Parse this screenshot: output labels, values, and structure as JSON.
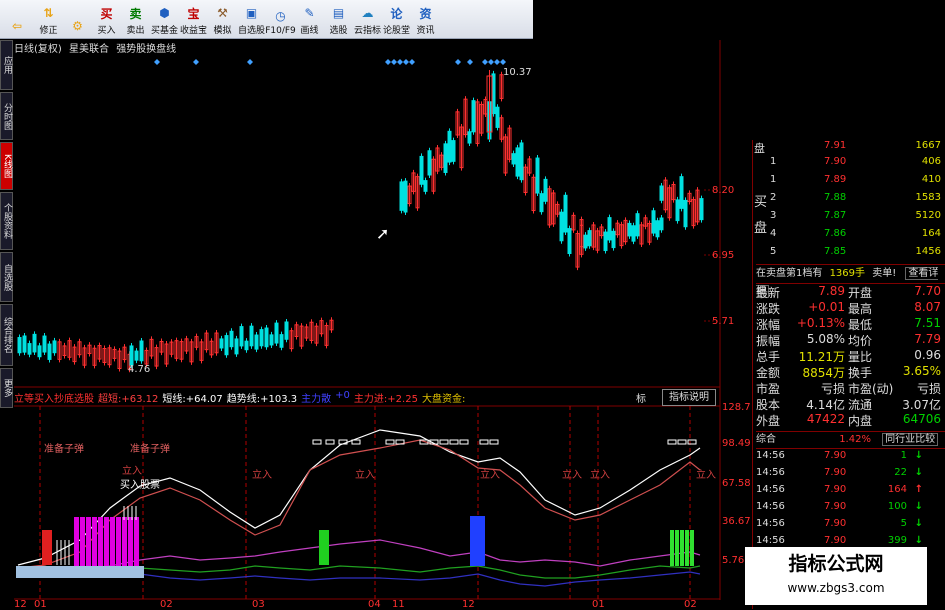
{
  "toolbar": {
    "buttons": [
      {
        "label": "",
        "icon": "back-arrow-icon",
        "glyph": "⇦",
        "color": "#e8a317"
      },
      {
        "label": "修正",
        "icon": "up-down-arrow-icon",
        "glyph": "⇅",
        "color": "#e8a317"
      },
      {
        "label": "",
        "icon": "settings-wheel-icon",
        "glyph": "⚙",
        "color": "#e8a317"
      },
      {
        "label": "买入",
        "icon": "buy-icon",
        "glyph": "买",
        "color": "#c00000"
      },
      {
        "label": "卖出",
        "icon": "sell-icon",
        "glyph": "卖",
        "color": "#007a00"
      },
      {
        "label": "买基金",
        "icon": "fund-icon",
        "glyph": "⬢",
        "color": "#2060c0"
      },
      {
        "label": "收益宝",
        "icon": "treasure-icon",
        "glyph": "宝",
        "color": "#c00000"
      },
      {
        "label": "模拟",
        "icon": "hammer-icon",
        "glyph": "⚒",
        "color": "#8a5a2a"
      },
      {
        "label": "自选股",
        "icon": "save-icon",
        "glyph": "▣",
        "color": "#2060c0"
      },
      {
        "label": "F10/F9",
        "icon": "clock-icon",
        "glyph": "◷",
        "color": "#2060c0"
      },
      {
        "label": "画线",
        "icon": "pencil-icon",
        "glyph": "✎",
        "color": "#2060c0"
      },
      {
        "label": "选股",
        "icon": "chart-icon",
        "glyph": "▤",
        "color": "#2060c0"
      },
      {
        "label": "云指标",
        "icon": "cloud-indicator-icon",
        "glyph": "☁",
        "color": "#2080c0"
      },
      {
        "label": "论股堂",
        "icon": "forum-icon",
        "glyph": "论",
        "color": "#2060c0"
      },
      {
        "label": "资讯",
        "icon": "news-icon",
        "glyph": "资",
        "color": "#2060c0"
      }
    ]
  },
  "sidebar": [
    {
      "label": "应用",
      "active": false
    },
    {
      "label": "分时图",
      "active": false
    },
    {
      "label": "K线图",
      "active": true
    },
    {
      "label": "个股资料",
      "active": false
    },
    {
      "label": "自选股",
      "active": false
    },
    {
      "label": "综合排名",
      "active": false
    },
    {
      "label": "更多",
      "active": false
    }
  ],
  "chart_header": {
    "period": "日线(复权)",
    "stock": "星美联合",
    "indicator": "强势股换盘线"
  },
  "main_chart": {
    "price_levels": [
      "8.20",
      "6.95",
      "5.71"
    ],
    "high_label": "10.37",
    "low_label": "4.76"
  },
  "indicator_bar": {
    "name": "立等买入抄底选股",
    "items": [
      {
        "label": "超短:",
        "value": "+63.12",
        "color": "#ff4040"
      },
      {
        "label": "短线:",
        "value": "+64.07",
        "color": "#ffffff"
      },
      {
        "label": "趋势线:",
        "value": "+103.3",
        "color": "#ffffff"
      },
      {
        "label": "主力散",
        "value": "",
        "color": "#4040ff"
      },
      {
        "label": "+0",
        "value": "",
        "color": "#4040ff"
      },
      {
        "label": "主力进:",
        "value": "+2.25",
        "color": "#ff3030"
      },
      {
        "label": "大盘资金:",
        "value": "",
        "color": "#e0c000"
      }
    ],
    "tab": "标",
    "button": "指标说明"
  },
  "lower_chart": {
    "levels": [
      "128.7",
      "98.49",
      "67.58",
      "36.67",
      "5.76"
    ],
    "signals": [
      "准备子弹",
      "准备子弹",
      "立入",
      "买入股票",
      "立入",
      "立入",
      "立入",
      "立入",
      "立入",
      "立入"
    ]
  },
  "date_axis": [
    "12",
    "01",
    "02",
    "03",
    "04",
    "11",
    "12",
    "01",
    "02"
  ],
  "order_book": {
    "sell": [
      {
        "label": "",
        "price": "7.91",
        "vol": "1667"
      },
      {
        "label": "1",
        "price": "7.90",
        "vol": "406"
      }
    ],
    "buy": [
      {
        "label": "1",
        "price": "7.89",
        "vol": "410"
      },
      {
        "label": "2",
        "price": "7.88",
        "vol": "1583"
      },
      {
        "label": "3",
        "price": "7.87",
        "vol": "5120"
      },
      {
        "label": "4",
        "price": "7.86",
        "vol": "164"
      },
      {
        "label": "5",
        "price": "7.85",
        "vol": "1456"
      }
    ],
    "side_label_buy": "买",
    "side_label_pan": "盘",
    "sell_side_label": "盘"
  },
  "depth_row": {
    "label": "在卖盘第1档有",
    "vol": "1369手",
    "sell1": "卖单!",
    "detail": "查看详细"
  },
  "quote": [
    {
      "k1": "最新",
      "v1": "7.89",
      "k2": "开盘",
      "v2": "7.70",
      "c1": "#ff3030",
      "c2": "#ff3030"
    },
    {
      "k1": "涨跌",
      "v1": "+0.01",
      "k2": "最高",
      "v2": "8.07",
      "c1": "#ff3030",
      "c2": "#ff3030"
    },
    {
      "k1": "涨幅",
      "v1": "+0.13%",
      "k2": "最低",
      "v2": "7.51",
      "c1": "#ff3030",
      "c2": "#00d000"
    },
    {
      "k1": "振幅",
      "v1": "5.08%",
      "k2": "均价",
      "v2": "7.79",
      "c1": "#dddddd",
      "c2": "#ff3030"
    },
    {
      "k1": "总手",
      "v1": "11.21万",
      "k2": "量比",
      "v2": "0.96",
      "c1": "#e0e000",
      "c2": "#dddddd"
    },
    {
      "k1": "金额",
      "v1": "8854万",
      "k2": "换手",
      "v2": "3.65%",
      "c1": "#e0e000",
      "c2": "#e0e000"
    },
    {
      "k1": "市盈",
      "v1": "亏损",
      "k2": "市盈(动)",
      "v2": "亏损",
      "c1": "#dddddd",
      "c2": "#dddddd"
    },
    {
      "k1": "股本",
      "v1": "4.14亿",
      "k2": "流通",
      "v2": "3.07亿",
      "c1": "#dddddd",
      "c2": "#dddddd"
    },
    {
      "k1": "外盘",
      "v1": "47422",
      "k2": "内盘",
      "v2": "64706",
      "c1": "#ff3030",
      "c2": "#00d000"
    }
  ],
  "summary": {
    "label": "综合",
    "value": "1.42%",
    "link": "同行业比较"
  },
  "ticks": [
    {
      "time": "14:56",
      "price": "7.90",
      "vol": "1",
      "dir": "down"
    },
    {
      "time": "14:56",
      "price": "7.90",
      "vol": "22",
      "dir": "down"
    },
    {
      "time": "14:56",
      "price": "7.90",
      "vol": "164",
      "dir": "up"
    },
    {
      "time": "14:56",
      "price": "7.90",
      "vol": "100",
      "dir": "down"
    },
    {
      "time": "14:56",
      "price": "7.90",
      "vol": "5",
      "dir": "down"
    },
    {
      "time": "14:56",
      "price": "7.90",
      "vol": "399",
      "dir": "down"
    }
  ],
  "watermark": {
    "title": "指标公式网",
    "url": "www.zbgs3.com"
  },
  "colors": {
    "up": "#ff3030",
    "down": "#00e0e0",
    "grid": "#800000",
    "diamond": "#40a0ff"
  }
}
